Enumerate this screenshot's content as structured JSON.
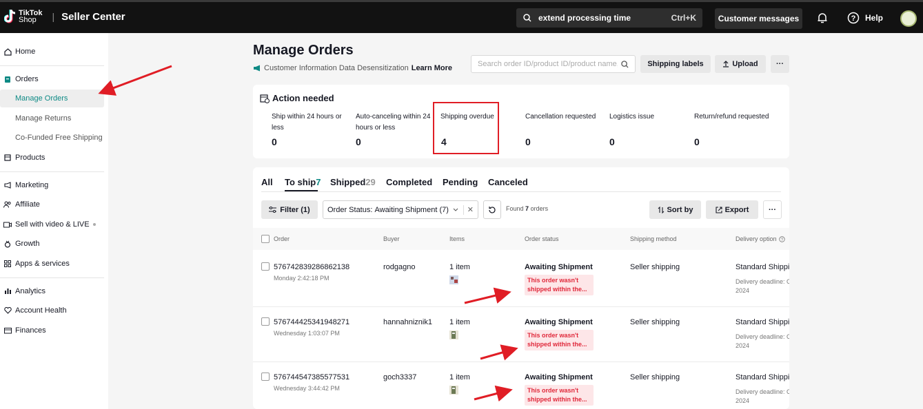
{
  "topbar": {
    "logo_line1": "TikTok",
    "logo_line2": "Shop",
    "app_name": "Seller Center",
    "search_value": "extend processing time",
    "search_shortcut": "Ctrl+K",
    "customer_messages": "Customer messages",
    "help": "Help"
  },
  "sidebar": {
    "home": "Home",
    "orders": "Orders",
    "manage_orders": "Manage Orders",
    "manage_returns": "Manage Returns",
    "cofunded": "Co-Funded Free Shipping",
    "products": "Products",
    "marketing": "Marketing",
    "affiliate": "Affiliate",
    "sell_video": "Sell with video & LIVE",
    "growth": "Growth",
    "apps": "Apps & services",
    "analytics": "Analytics",
    "account_health": "Account Health",
    "finances": "Finances"
  },
  "header": {
    "title": "Manage Orders",
    "desensitization": "Customer Information Data Desensitization",
    "learn_more": "Learn More",
    "search_placeholder": "Search order ID/product ID/product name, tracking",
    "shipping_labels": "Shipping labels",
    "upload": "Upload",
    "more": "···"
  },
  "action_needed": {
    "title": "Action needed",
    "metrics": [
      {
        "label_1": "Ship within 24 hours or",
        "label_2": "less",
        "value": "0"
      },
      {
        "label_1": "Auto-canceling within 24",
        "label_2": "hours or less",
        "value": "0"
      },
      {
        "label_1": "Shipping overdue",
        "label_2": "",
        "value": "4"
      },
      {
        "label_1": "Cancellation requested",
        "label_2": "",
        "value": "0"
      },
      {
        "label_1": "Logistics issue",
        "label_2": "",
        "value": "0"
      },
      {
        "label_1": "Return/refund requested",
        "label_2": "",
        "value": "0"
      }
    ]
  },
  "tabs": {
    "all": "All",
    "to_ship": "To ship",
    "to_ship_count": "7",
    "shipped": "Shipped",
    "shipped_count": "29",
    "completed": "Completed",
    "pending": "Pending",
    "canceled": "Canceled"
  },
  "toolbar": {
    "filter": "Filter",
    "filter_count": "(1)",
    "status_label": "Order Status:",
    "status_value": "Awaiting Shipment (7)",
    "found_prefix": "Found",
    "found_count": "7",
    "found_suffix": "orders",
    "sort_by": "Sort by",
    "export": "Export",
    "more": "···"
  },
  "table": {
    "headers": {
      "order": "Order",
      "buyer": "Buyer",
      "items": "Items",
      "order_status": "Order status",
      "shipping_method": "Shipping method",
      "delivery_option": "Delivery option"
    },
    "rows": [
      {
        "id": "576742839286862138",
        "time": "Monday 2:42:18 PM",
        "buyer": "rodgagno",
        "items": "1 item",
        "status": "Awaiting Shipment",
        "warn_1": "This order wasn't",
        "warn_2": "shipped within the...",
        "method": "Seller shipping",
        "delivery": "Standard Shipping",
        "deadline_1": "Delivery deadline: Oct",
        "deadline_2": "2024"
      },
      {
        "id": "576744425341948271",
        "time": "Wednesday 1:03:07 PM",
        "buyer": "hannahniznik1",
        "items": "1 item",
        "status": "Awaiting Shipment",
        "warn_1": "This order wasn't",
        "warn_2": "shipped within the...",
        "method": "Seller shipping",
        "delivery": "Standard Shipping",
        "deadline_1": "Delivery deadline: Oct",
        "deadline_2": "2024"
      },
      {
        "id": "576744547385577531",
        "time": "Wednesday 3:44:42 PM",
        "buyer": "goch3337",
        "items": "1 item",
        "status": "Awaiting Shipment",
        "warn_1": "This order wasn't",
        "warn_2": "shipped within the...",
        "method": "Seller shipping",
        "delivery": "Standard Shipping",
        "deadline_1": "Delivery deadline: Oct",
        "deadline_2": "2024"
      }
    ]
  },
  "colors": {
    "accent": "#0e8a85",
    "annotation_red": "#e01d25",
    "warning_bg": "#fde6e8",
    "warning_text": "#e0283a",
    "topbar": "#121212"
  }
}
